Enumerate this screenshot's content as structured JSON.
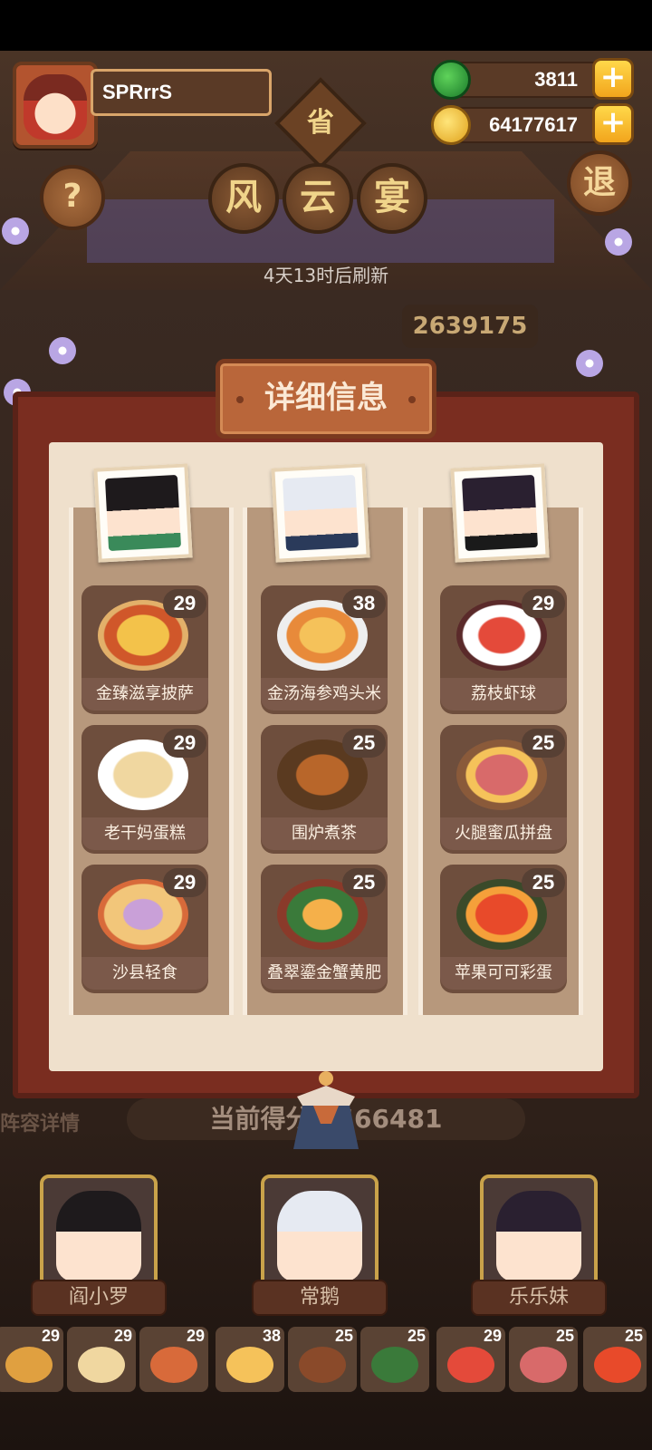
{
  "player": {
    "name": "SPRrrS"
  },
  "resources": {
    "jade": "3811",
    "coins": "64177617",
    "plus_label": "+"
  },
  "buttons": {
    "help": "?",
    "exit": "退"
  },
  "province_badge": "省",
  "event": {
    "title_chars": [
      "风",
      "云",
      "宴"
    ],
    "refresh_text": "4天13时后刷新",
    "top_score": "2639175"
  },
  "panel": {
    "title": "详细信息",
    "columns": [
      {
        "dishes": [
          {
            "name": "金臻滋享披萨",
            "count": "29"
          },
          {
            "name": "老干妈蛋糕",
            "count": "29"
          },
          {
            "name": "沙县轻食",
            "count": "29"
          }
        ]
      },
      {
        "dishes": [
          {
            "name": "金汤海参鸡头米",
            "count": "38"
          },
          {
            "name": "围炉煮茶",
            "count": "25"
          },
          {
            "name": "叠翠鎏金蟹黄肥",
            "count": "25"
          }
        ]
      },
      {
        "dishes": [
          {
            "name": "荔枝虾球",
            "count": "29"
          },
          {
            "name": "火腿蜜瓜拼盘",
            "count": "25"
          },
          {
            "name": "苹果可可彩蛋",
            "count": "25"
          }
        ]
      }
    ]
  },
  "current_score": "当前得分：566481",
  "lineup_label": "阵容详情",
  "characters": [
    {
      "name": "阎小罗"
    },
    {
      "name": "常鹅"
    },
    {
      "name": "乐乐妹"
    }
  ],
  "bottom_dishes": [
    "29",
    "29",
    "29",
    "38",
    "25",
    "25",
    "29",
    "25",
    "25"
  ],
  "colors": {
    "panel_frame": "#7a2d20",
    "panel_paper": "#efe0cc",
    "card": "#6e4e3d",
    "gold": "#f2a51c"
  }
}
